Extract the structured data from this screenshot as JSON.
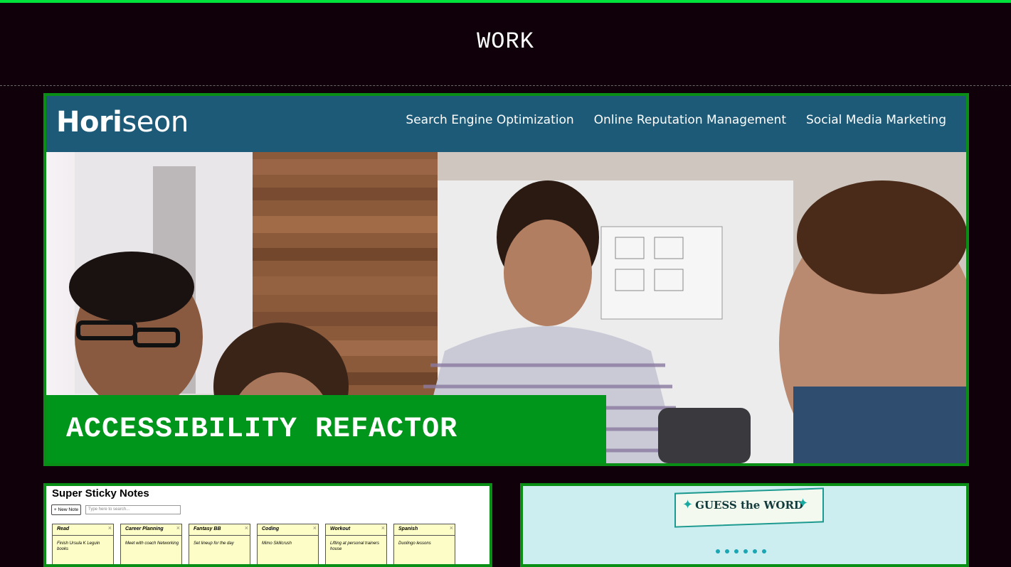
{
  "section": {
    "title": "WORK"
  },
  "featured": {
    "site": {
      "logo_bold": "Hori",
      "logo_light": "seon",
      "nav": [
        "Search Engine Optimization",
        "Online Reputation Management",
        "Social Media Marketing"
      ]
    },
    "label": "ACCESSIBILITY REFACTOR"
  },
  "sticky_notes": {
    "title": "Super Sticky Notes",
    "new_note_label": "+ New Note",
    "search_placeholder": "Type here to search...",
    "notes": [
      {
        "title": "Read",
        "body": "Finish Ursula K Leguin books"
      },
      {
        "title": "Career Planning",
        "body": "Meet with coach Networking"
      },
      {
        "title": "Fantasy BB",
        "body": "Set lineup for the day"
      },
      {
        "title": "Coding",
        "body": "Mimo Skillcrush"
      },
      {
        "title": "Workout",
        "body": "Lifting at personal trainers house"
      },
      {
        "title": "Spanish",
        "body": "Duolingo lessons"
      }
    ]
  },
  "guess_word": {
    "title": "GUESS the WORD",
    "placeholder_letters": 6
  },
  "colors": {
    "accent_green": "#00961b",
    "border_green": "#0a8f16",
    "background": "#0f0009"
  }
}
